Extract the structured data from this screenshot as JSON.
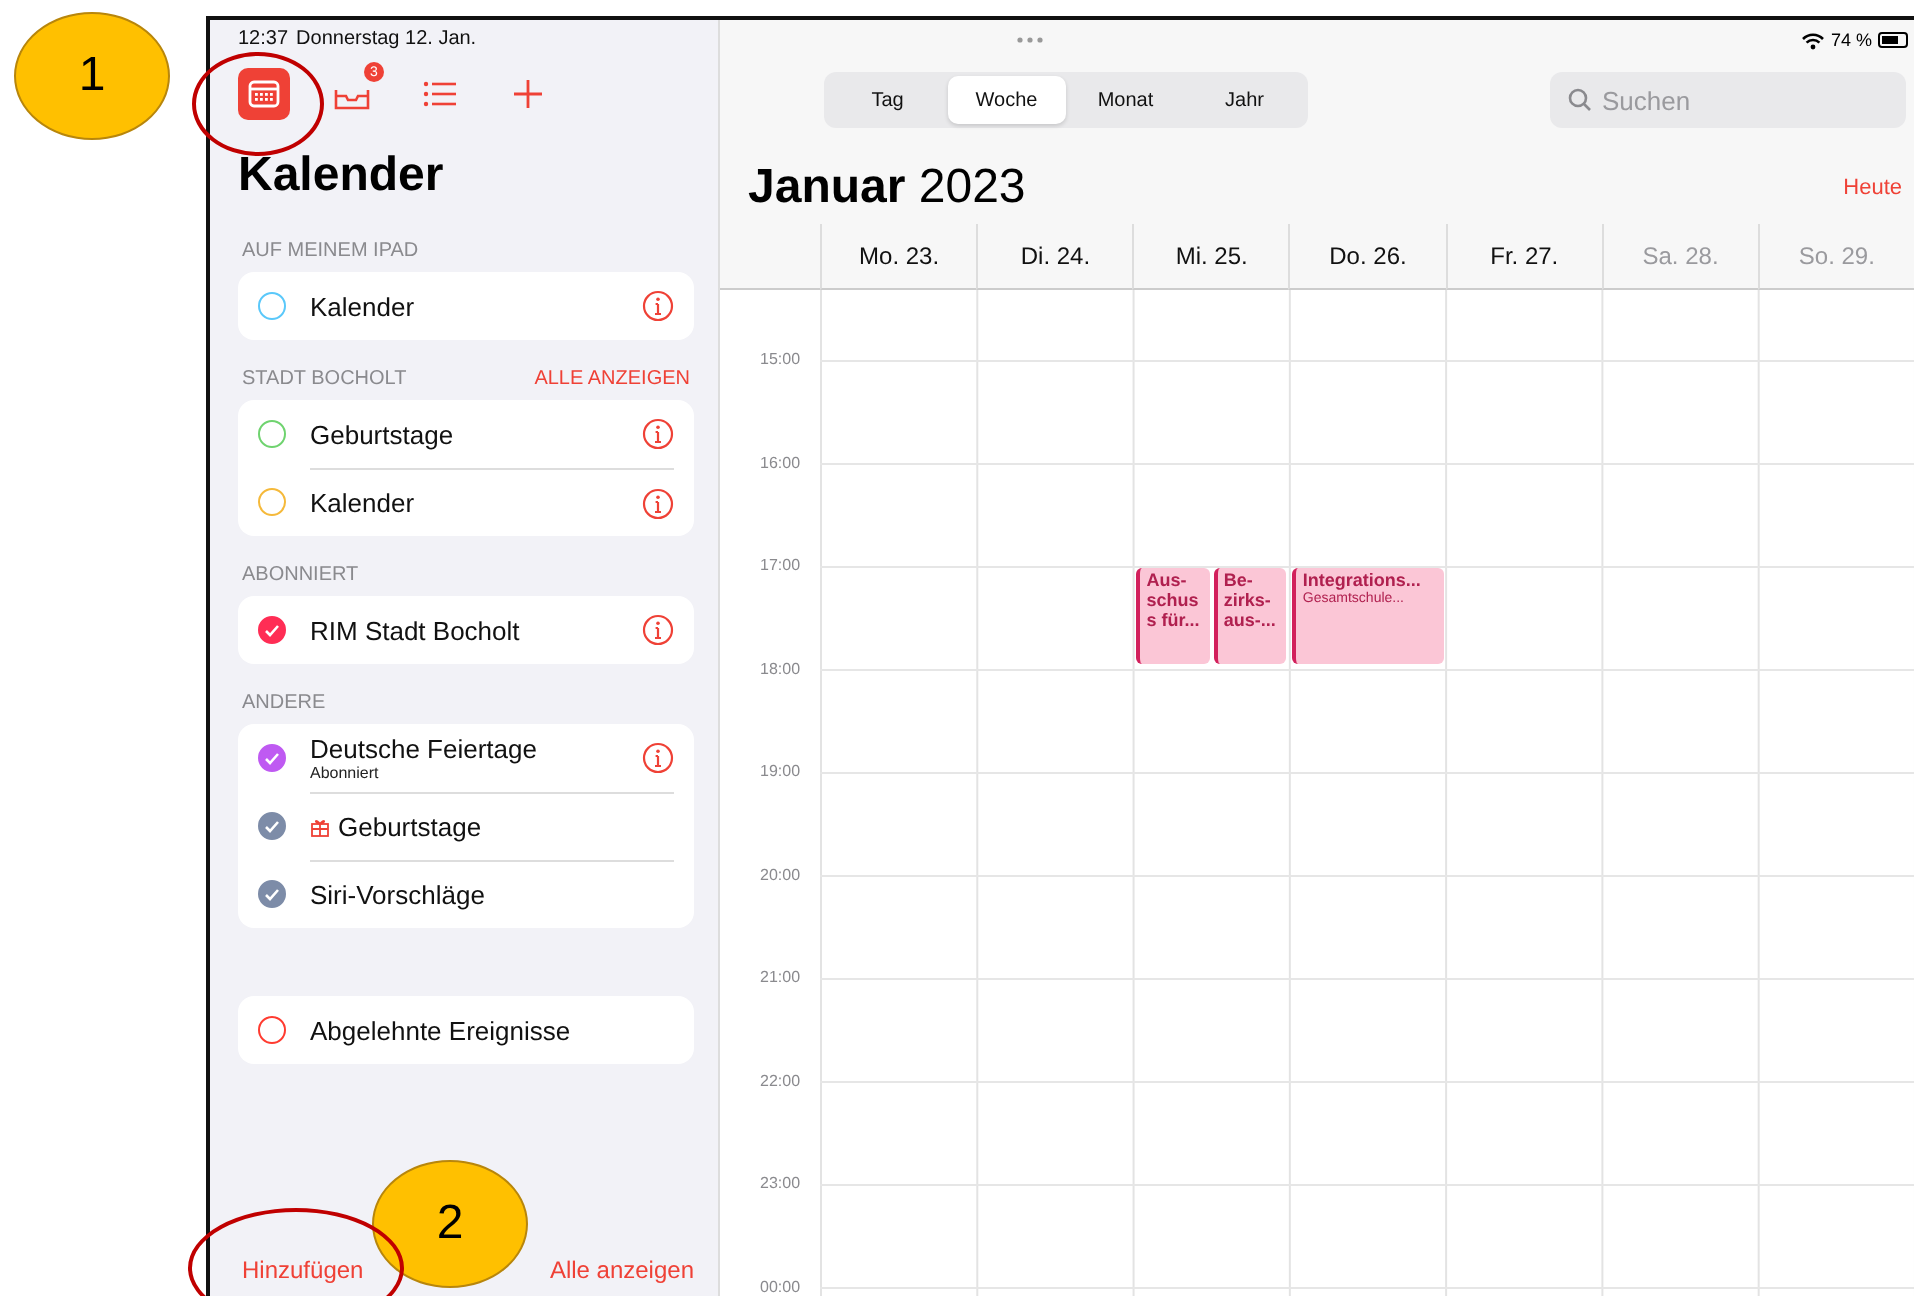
{
  "status_bar": {
    "time": "12:37",
    "date": "Donnerstag 12. Jan.",
    "battery": "74 %"
  },
  "sidebar": {
    "toolbar": [
      {
        "kind": "calendar",
        "selected": true
      },
      {
        "kind": "inbox",
        "selected": false,
        "badge": "3"
      },
      {
        "kind": "list",
        "selected": false
      },
      {
        "kind": "add",
        "selected": false
      }
    ],
    "title": "Kalender",
    "sections": [
      {
        "header": "AUF MEINEM IPAD",
        "items": [
          {
            "name": "Kalender",
            "color": "#5ac8fa",
            "checked": false,
            "info": true
          }
        ]
      },
      {
        "header": "STADT BOCHOLT",
        "action": "ALLE ANZEIGEN",
        "items": [
          {
            "name": "Geburtstage",
            "color": "#6fd36f",
            "checked": false,
            "info": true
          },
          {
            "name": "Kalender",
            "color": "#f5b93a",
            "checked": false,
            "info": true
          }
        ]
      },
      {
        "header": "ABONNIERT",
        "items": [
          {
            "name": "RIM Stadt Bocholt",
            "color": "#ff2d55",
            "checked": true,
            "info": true
          }
        ]
      },
      {
        "header": "ANDERE",
        "items": [
          {
            "name": "Deutsche Feiertage",
            "subtitle": "Abonniert",
            "color": "#bf5af2",
            "checked": true,
            "info": true
          },
          {
            "name": "Geburtstage",
            "color": "#7d8ca8",
            "checked": true,
            "info": false,
            "gift": true
          },
          {
            "name": "Siri-Vorschläge",
            "color": "#7d8ca8",
            "checked": true,
            "info": false
          }
        ]
      },
      {
        "items": [
          {
            "name": "Abgelehnte Ereignisse",
            "color": "#ff3b30",
            "checked": false,
            "info": false
          }
        ]
      }
    ],
    "footer": {
      "add": "Hinzufügen",
      "show_all": "Alle anzeigen"
    }
  },
  "main": {
    "views": [
      {
        "label": "Tag",
        "selected": false
      },
      {
        "label": "Woche",
        "selected": true
      },
      {
        "label": "Monat",
        "selected": false
      },
      {
        "label": "Jahr",
        "selected": false
      }
    ],
    "search": {
      "placeholder": "Suchen"
    },
    "month": "Januar",
    "year": "2023",
    "today": "Heute",
    "days": [
      {
        "label": "Mo. 23.",
        "weekend": false
      },
      {
        "label": "Di. 24.",
        "weekend": false
      },
      {
        "label": "Mi. 25.",
        "weekend": false
      },
      {
        "label": "Do. 26.",
        "weekend": false
      },
      {
        "label": "Fr. 27.",
        "weekend": false
      },
      {
        "label": "Sa. 28.",
        "weekend": true
      },
      {
        "label": "So. 29.",
        "weekend": true
      }
    ],
    "hours": [
      {
        "label": "15:00"
      },
      {
        "label": "16:00"
      },
      {
        "label": "17:00",
        "cells": [
          {},
          {},
          {
            "events": [
              {
                "title_lines": [
                  "Aus-",
                  "schus",
                  "s für..."
                ]
              },
              {
                "title_lines": [
                  "Be-",
                  "zirks-",
                  "aus-..."
                ]
              }
            ]
          },
          {
            "events": [
              {
                "title_lines": [
                  "Integrations..."
                ],
                "subtitle": "Gesamtschule..."
              }
            ]
          },
          {},
          {},
          {}
        ]
      },
      {
        "label": "18:00"
      },
      {
        "label": "19:00"
      },
      {
        "label": "20:00"
      },
      {
        "label": "21:00"
      },
      {
        "label": "22:00"
      },
      {
        "label": "23:00"
      },
      {
        "label": "00:00"
      }
    ]
  },
  "annotations": [
    {
      "label": "1"
    },
    {
      "label": "2"
    }
  ]
}
